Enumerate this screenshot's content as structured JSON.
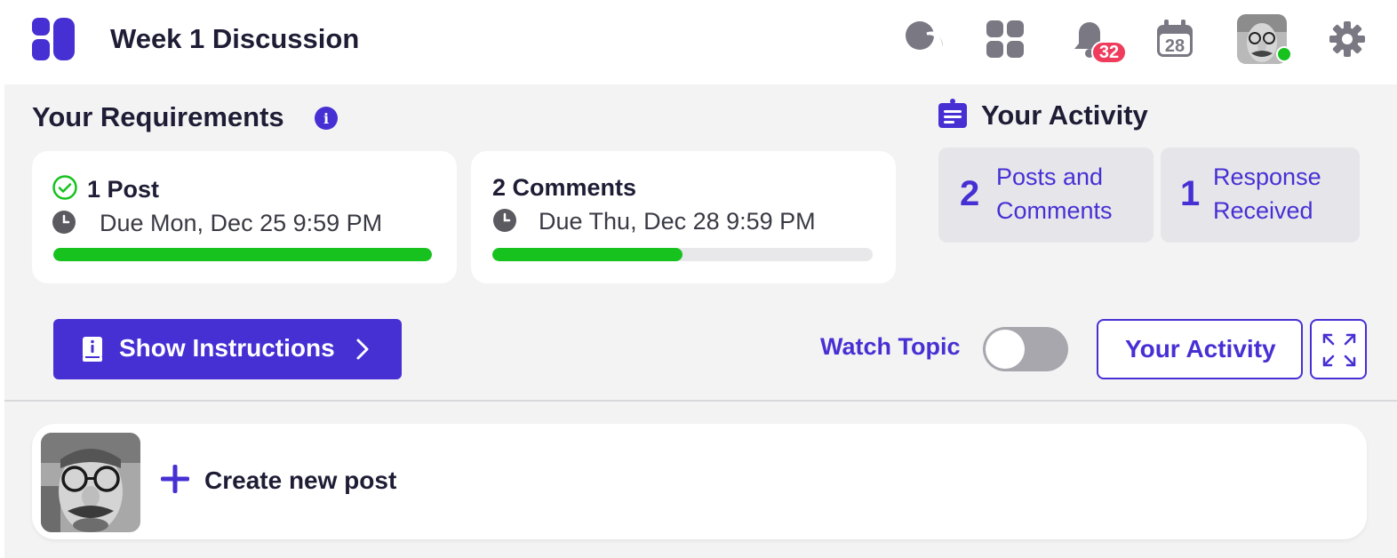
{
  "header": {
    "title": "Week 1 Discussion",
    "notification_count": "32",
    "calendar_day": "28",
    "icons": [
      "logo-icon",
      "chat-icon",
      "apps-grid-icon",
      "bell-icon",
      "calendar-icon",
      "avatar",
      "gear-icon"
    ]
  },
  "requirements": {
    "title": "Your Requirements",
    "info_glyph": "i",
    "cards": [
      {
        "label": "1 Post",
        "due": "Due Mon, Dec 25 9:59 PM",
        "progress": 1.0,
        "completed": true
      },
      {
        "label": "2 Comments",
        "due": "Due Thu, Dec 28 9:59 PM",
        "progress": 0.5,
        "completed": false
      }
    ]
  },
  "activity": {
    "title": "Your Activity",
    "stats": [
      {
        "value": "2",
        "line1": "Posts and",
        "line2": "Comments"
      },
      {
        "value": "1",
        "line1": "Response",
        "line2": "Received"
      }
    ]
  },
  "actions": {
    "show_instructions": "Show Instructions",
    "watch_topic": "Watch Topic",
    "watch_enabled": false,
    "your_activity": "Your Activity"
  },
  "composer": {
    "create_label": "Create new post"
  },
  "colors": {
    "accent": "#4630d4",
    "success": "#17c21f",
    "badge": "#ef3c5c",
    "panel_bg": "#f3f3f4"
  }
}
